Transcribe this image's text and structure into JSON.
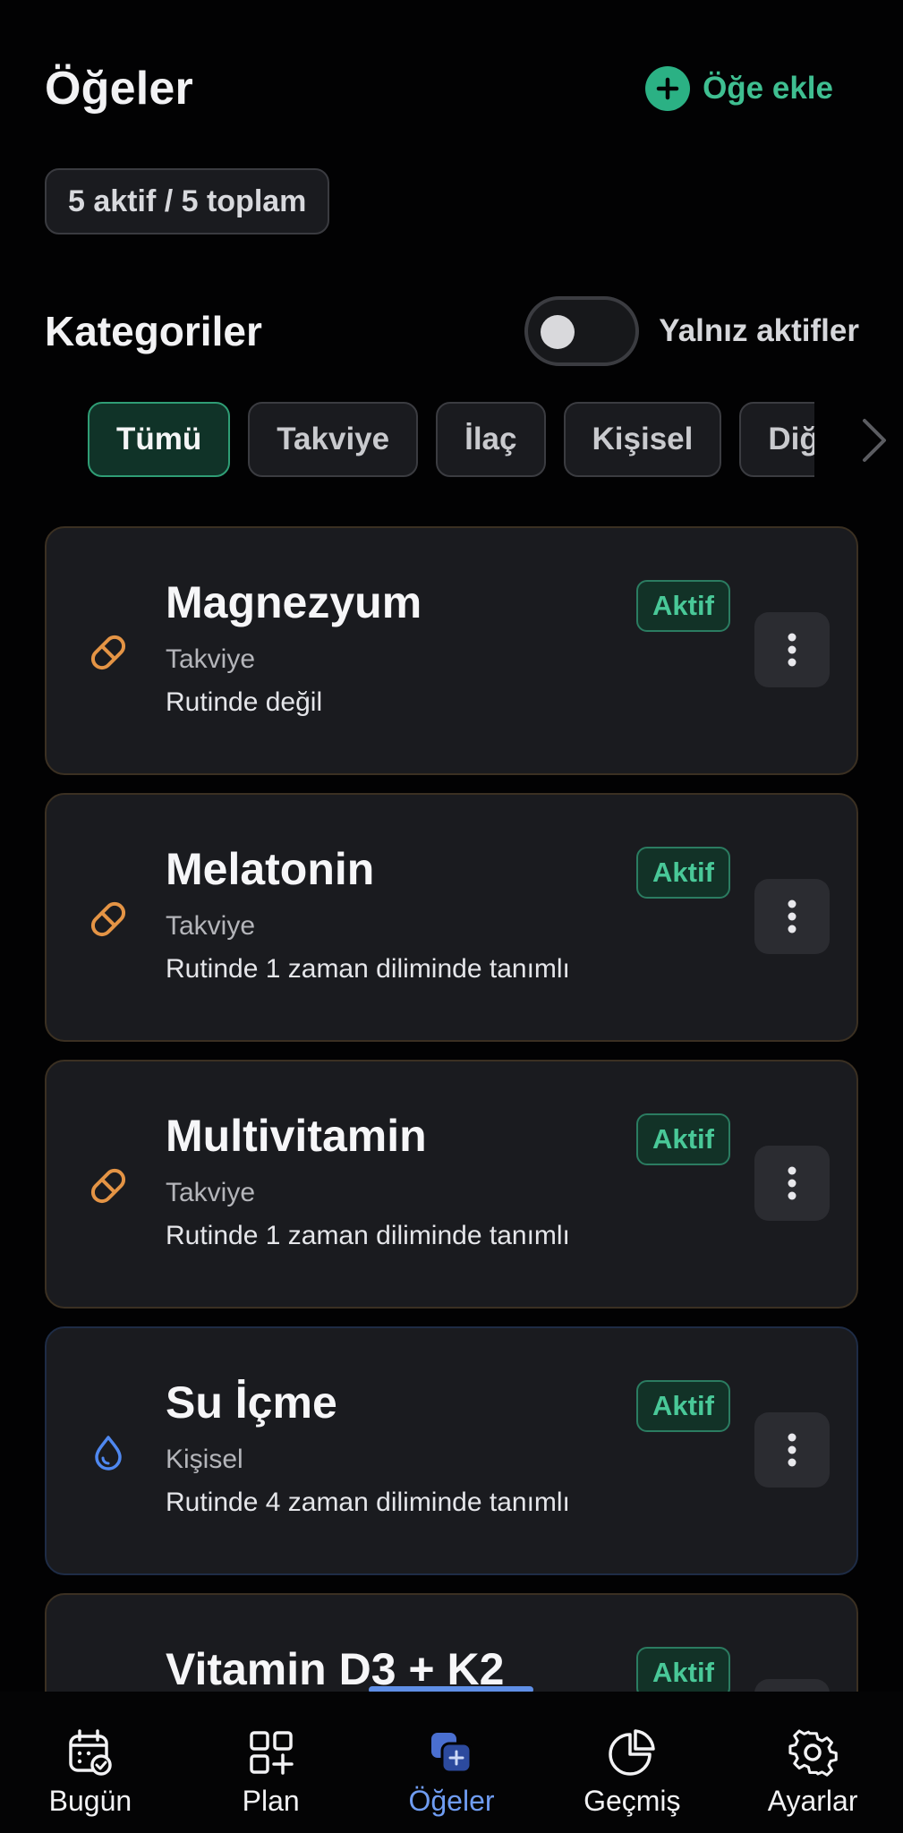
{
  "header": {
    "title": "Öğeler",
    "add_label": "Öğe ekle"
  },
  "summary": {
    "count_text": "5 aktif / 5 toplam"
  },
  "categories": {
    "title": "Kategoriler",
    "toggle_label": "Yalnız aktifler",
    "toggle_on": false,
    "chips": [
      {
        "label": "Tümü",
        "active": true
      },
      {
        "label": "Takviye",
        "active": false
      },
      {
        "label": "İlaç",
        "active": false
      },
      {
        "label": "Kişisel",
        "active": false
      },
      {
        "label": "Diğer",
        "active": false
      }
    ]
  },
  "items": [
    {
      "name": "Magnezyum",
      "category": "Takviye",
      "routine": "Rutinde değil",
      "status": "Aktif",
      "icon": "pill-icon"
    },
    {
      "name": "Melatonin",
      "category": "Takviye",
      "routine": "Rutinde 1 zaman diliminde tanımlı",
      "status": "Aktif",
      "icon": "pill-icon"
    },
    {
      "name": "Multivitamin",
      "category": "Takviye",
      "routine": "Rutinde 1 zaman diliminde tanımlı",
      "status": "Aktif",
      "icon": "pill-icon"
    },
    {
      "name": "Su İçme",
      "category": "Kişisel",
      "routine": "Rutinde 4 zaman diliminde tanımlı",
      "status": "Aktif",
      "icon": "water-drop-icon"
    },
    {
      "name": "Vitamin D3 + K2",
      "category": "",
      "routine": "",
      "status": "Aktif",
      "icon": "pill-icon"
    }
  ],
  "nav": [
    {
      "label": "Bugün",
      "icon": "calendar-check-icon",
      "active": false
    },
    {
      "label": "Plan",
      "icon": "grid-plus-icon",
      "active": false
    },
    {
      "label": "Öğeler",
      "icon": "items-icon",
      "active": true
    },
    {
      "label": "Geçmiş",
      "icon": "pie-chart-icon",
      "active": false
    },
    {
      "label": "Ayarlar",
      "icon": "gear-icon",
      "active": false
    }
  ],
  "colors": {
    "accent_green": "#2bb184",
    "accent_blue": "#6f9cf2",
    "pill_orange": "#e49445",
    "drop_blue": "#4f88f0"
  }
}
